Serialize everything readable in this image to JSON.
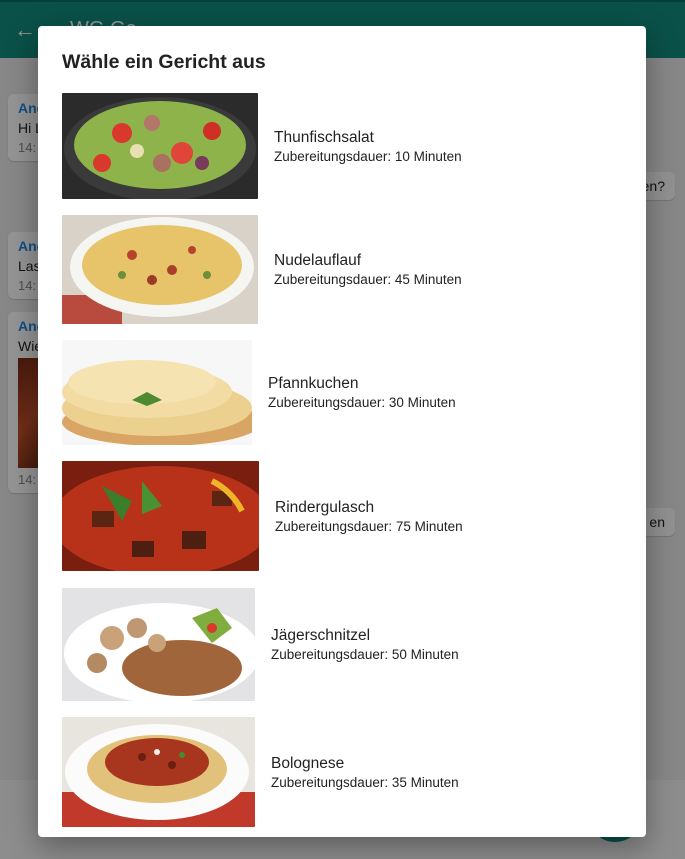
{
  "chat": {
    "title": "WG Ge",
    "back_icon": "arrow-left-icon",
    "messages": [
      {
        "sender": "And",
        "text": "Hi L",
        "time": "14:"
      },
      {
        "text": "en?"
      },
      {
        "sender": "And",
        "text": "Las",
        "time": "14:"
      },
      {
        "sender": "And",
        "text": "Wie",
        "time": "14:"
      },
      {
        "text": "en"
      }
    ]
  },
  "dialog": {
    "title": "Wähle ein Gericht aus",
    "dishes": [
      {
        "name": "Thunfischsalat",
        "duration": "Zubereitungsdauer: 10 Minuten"
      },
      {
        "name": "Nudelauflauf",
        "duration": "Zubereitungsdauer: 45 Minuten"
      },
      {
        "name": "Pfannkuchen",
        "duration": "Zubereitungsdauer: 30 Minuten"
      },
      {
        "name": "Rindergulasch",
        "duration": "Zubereitungsdauer: 75 Minuten"
      },
      {
        "name": "Jägerschnitzel",
        "duration": "Zubereitungsdauer: 50 Minuten"
      },
      {
        "name": "Bolognese",
        "duration": "Zubereitungsdauer: 35 Minuten"
      }
    ]
  },
  "colors": {
    "primary": "#128c7e",
    "overlay": "rgba(0,0,0,0.42)",
    "accent_blue": "#1e88e5"
  }
}
